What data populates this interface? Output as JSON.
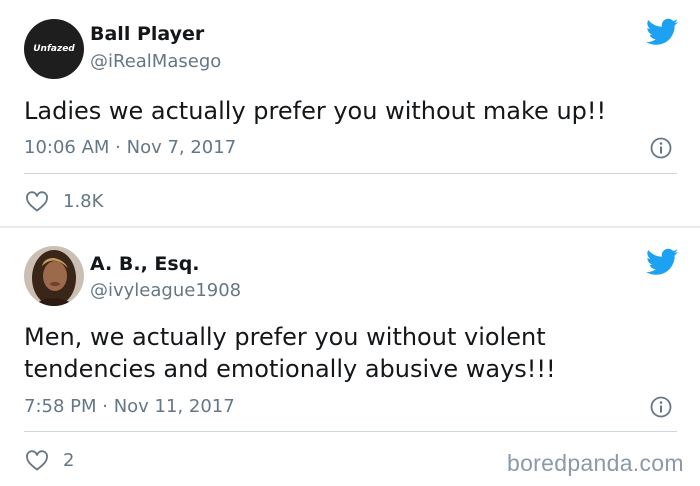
{
  "tweets": [
    {
      "name": "Ball Player",
      "handle": "@iRealMasego",
      "avatar_text": "Unfazed",
      "text": "Ladies we actually prefer you without make up!!",
      "meta": "10:06 AM · Nov 7, 2017",
      "likes": "1.8K"
    },
    {
      "name": "A. B., Esq.",
      "handle": "@ivyleague1908",
      "text": "Men, we actually prefer you without violent tendencies and emotionally abusive ways!!!",
      "meta": "7:58 PM · Nov 11, 2017",
      "likes": "2"
    }
  ],
  "watermark": "boredpanda.com",
  "colors": {
    "twitter_blue": "#1da1f2",
    "secondary_text": "#657786",
    "primary_text": "#14171a"
  },
  "icons": [
    "twitter-bird-icon",
    "info-icon",
    "heart-icon"
  ]
}
